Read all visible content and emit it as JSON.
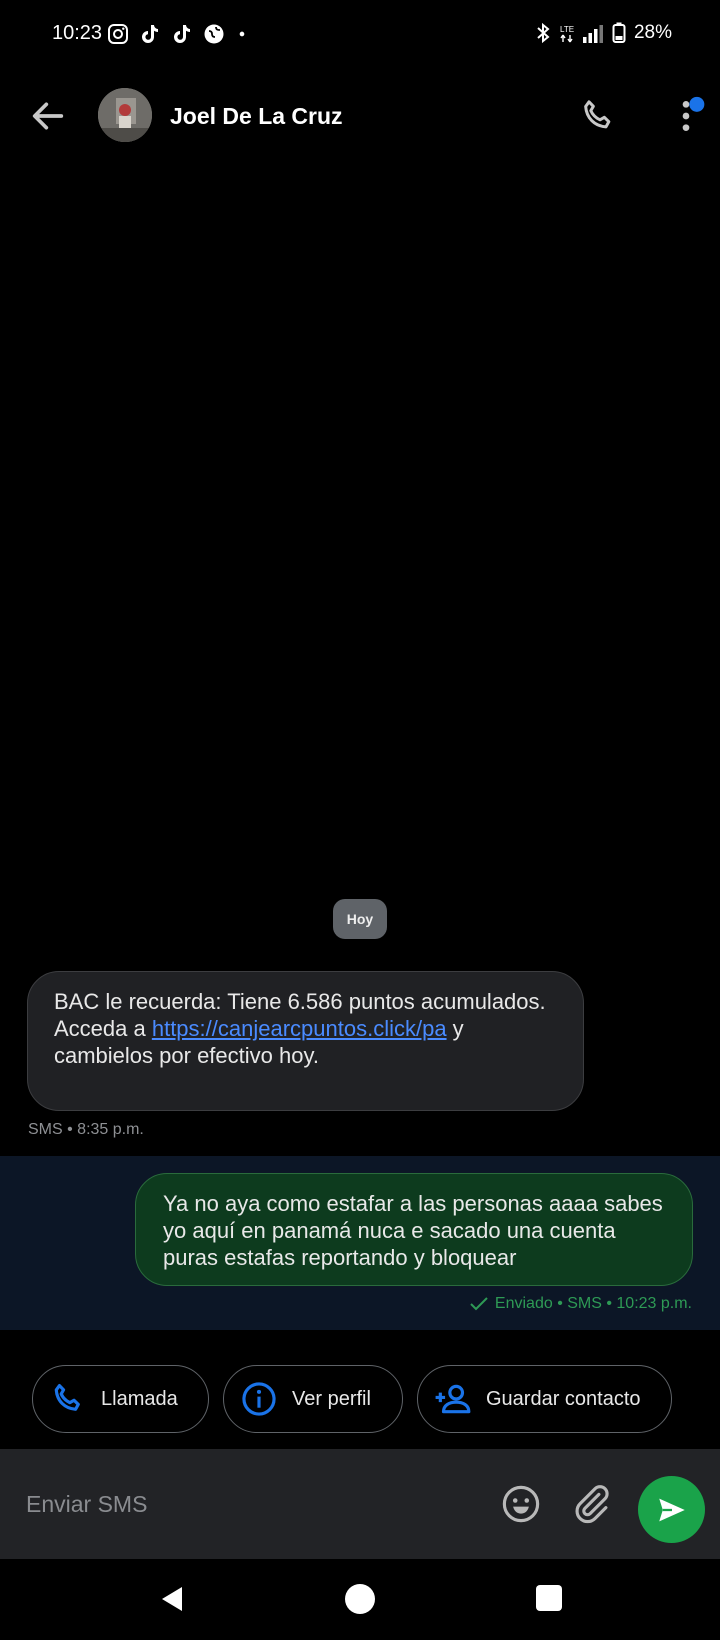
{
  "status_bar": {
    "time": "10:23",
    "notification_icons": [
      "instagram-icon",
      "tiktok-icon",
      "tiktok-icon",
      "browser-icon",
      "dot-icon"
    ],
    "system_icons": [
      "bluetooth-icon",
      "lte-icon",
      "signal-icon",
      "battery-icon"
    ],
    "battery": "28%"
  },
  "app_bar": {
    "contact_name": "Joel De La Cruz",
    "icons": [
      "back-arrow-icon",
      "phone-icon",
      "more-vert-icon"
    ],
    "badge_color": "#1a73e8"
  },
  "conversation": {
    "date_chip": "Hoy",
    "incoming": {
      "text_before_link": "BAC le recuerda: Tiene 6.586 puntos acumulados. Acceda a ",
      "link": "https://canjearcpuntos.click/pa",
      "text_after_link": " y cambielos por efectivo hoy.",
      "meta": "SMS • 8:35 p.m."
    },
    "outgoing": {
      "text": "Ya no aya como estafar a las personas aaaa sabes yo aquí en panamá nuca e sacado una cuenta puras estafas reportando y bloquear",
      "meta": "Enviado • SMS • 10:23 p.m."
    }
  },
  "actions": {
    "call_label": "Llamada",
    "profile_label": "Ver perfil",
    "save_contact_label": "Guardar contacto"
  },
  "composer": {
    "placeholder": "Enviar SMS",
    "icons": [
      "emoji-icon",
      "attach-icon",
      "send-icon"
    ]
  },
  "colors": {
    "accent_blue": "#1a73e8",
    "sent_bubble": "#0d3b1e",
    "send_button": "#1aa34a",
    "link": "#4a8bff"
  }
}
